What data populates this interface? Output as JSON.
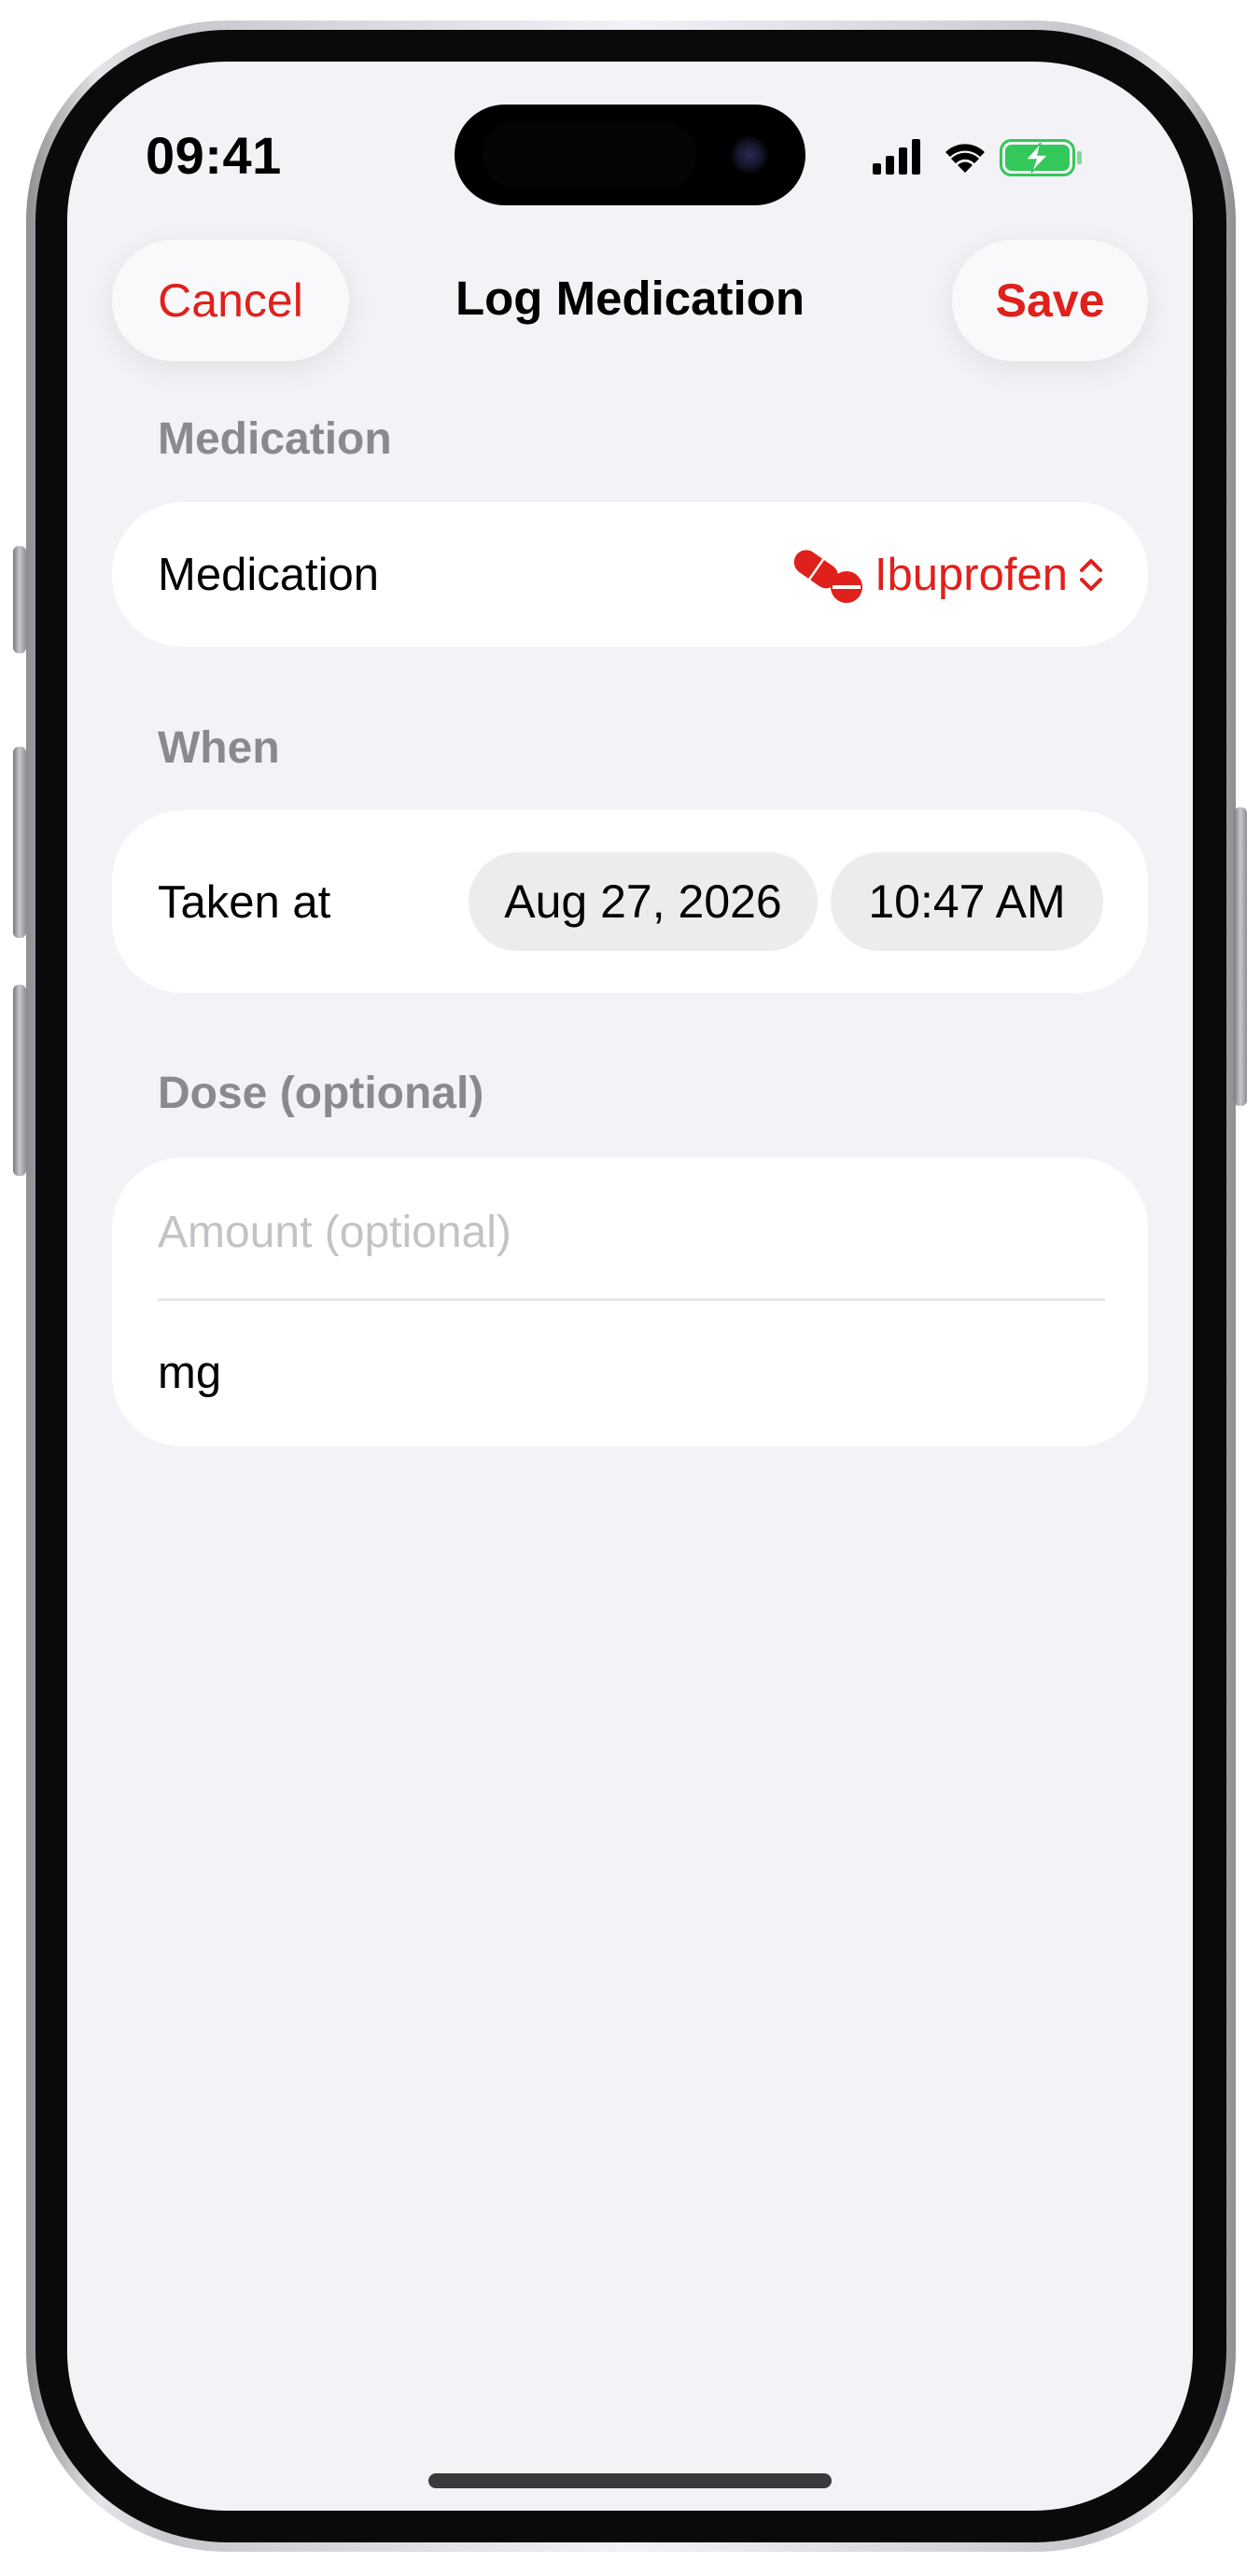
{
  "status_bar": {
    "time": "09:41"
  },
  "nav": {
    "cancel_label": "Cancel",
    "title": "Log Medication",
    "save_label": "Save"
  },
  "sections": {
    "medication": {
      "header": "Medication",
      "row_label": "Medication",
      "selected_value": "Ibuprofen",
      "icon": "pills-icon",
      "chevron": "chevron-up-down-icon"
    },
    "when": {
      "header": "When",
      "row_label": "Taken at",
      "date": "Aug 27, 2026",
      "time": "10:47 AM"
    },
    "dose": {
      "header": "Dose (optional)",
      "amount_placeholder": "Amount (optional)",
      "amount_value": "",
      "unit": "mg"
    }
  },
  "colors": {
    "accent": "#e0201b",
    "background": "#f2f2f7",
    "card": "#ffffff",
    "secondary_text": "#8a8a8e",
    "placeholder": "#c3c3c7",
    "battery_green": "#34c759"
  }
}
